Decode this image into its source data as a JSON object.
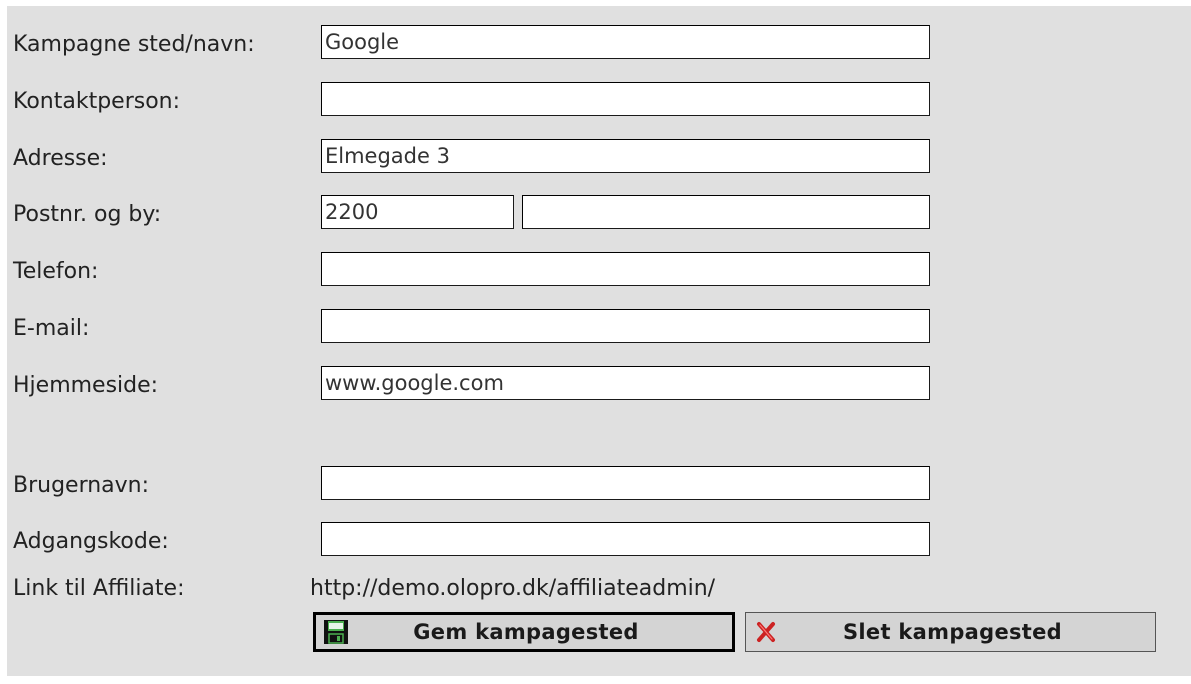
{
  "form": {
    "campaign_name": {
      "label": "Kampagne sted/navn:",
      "value": "Google"
    },
    "contact_person": {
      "label": "Kontaktperson:",
      "value": ""
    },
    "address": {
      "label": "Adresse:",
      "value": "Elmegade 3"
    },
    "postal_city": {
      "label": "Postnr. og by:",
      "postal_value": "2200",
      "city_value": ""
    },
    "phone": {
      "label": "Telefon:",
      "value": ""
    },
    "email": {
      "label": "E-mail:",
      "value": ""
    },
    "website": {
      "label": "Hjemmeside:",
      "value": "www.google.com"
    },
    "username": {
      "label": "Brugernavn:",
      "value": ""
    },
    "password": {
      "label": "Adgangskode:",
      "value": ""
    },
    "affiliate_link": {
      "label": "Link til Affiliate:",
      "value": "http://demo.olopro.dk/affiliateadmin/"
    }
  },
  "buttons": {
    "save": {
      "label": "Gem kampagested",
      "icon": "floppy-disk-icon"
    },
    "delete": {
      "label": "Slet kampagested",
      "icon": "red-x-icon"
    }
  },
  "colors": {
    "panel_background": "#e0e0e0",
    "button_background": "#d4d4d4",
    "delete_icon": "#cc2222",
    "save_icon": "#2e7d32"
  }
}
